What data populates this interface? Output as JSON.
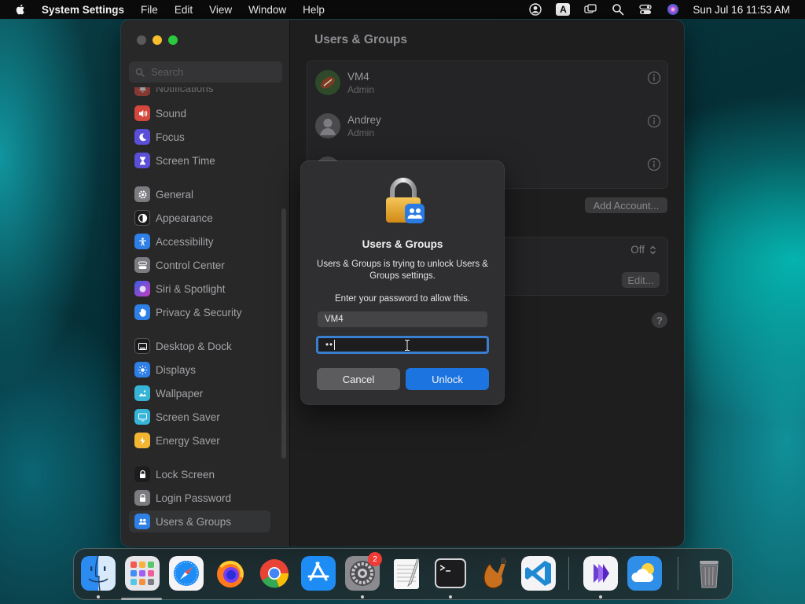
{
  "menubar": {
    "app_name": "System Settings",
    "items": [
      "File",
      "Edit",
      "View",
      "Window",
      "Help"
    ],
    "input_source": "A",
    "clock": "Sun Jul 16  11:53 AM"
  },
  "window": {
    "title": "Users & Groups",
    "search_placeholder": "Search",
    "sidebar": [
      {
        "label": "Notifications",
        "icon": "bell-icon",
        "color": "#e0473c"
      },
      {
        "label": "Sound",
        "icon": "speaker-icon",
        "color": "#e0473c"
      },
      {
        "label": "Focus",
        "icon": "moon-icon",
        "color": "#5b4fd8"
      },
      {
        "label": "Screen Time",
        "icon": "hourglass-icon",
        "color": "#5b4fd8"
      },
      {
        "label": "General",
        "icon": "gear-icon",
        "color": "#8e8e93"
      },
      {
        "label": "Appearance",
        "icon": "appearance-icon",
        "color": "#1c1c1e"
      },
      {
        "label": "Accessibility",
        "icon": "accessibility-icon",
        "color": "#2e7fe6"
      },
      {
        "label": "Control Center",
        "icon": "control-center-icon",
        "color": "#8e8e93"
      },
      {
        "label": "Siri & Spotlight",
        "icon": "siri-icon",
        "color": "#c53dc4"
      },
      {
        "label": "Privacy & Security",
        "icon": "hand-icon",
        "color": "#2e7fe6"
      },
      {
        "label": "Desktop & Dock",
        "icon": "dock-icon",
        "color": "#1c1c1e"
      },
      {
        "label": "Displays",
        "icon": "sun-icon",
        "color": "#2e7fe6"
      },
      {
        "label": "Wallpaper",
        "icon": "wallpaper-icon",
        "color": "#36b5d8"
      },
      {
        "label": "Screen Saver",
        "icon": "screen-saver-icon",
        "color": "#36b5d8"
      },
      {
        "label": "Energy Saver",
        "icon": "battery-icon",
        "color": "#f2b632"
      },
      {
        "label": "Lock Screen",
        "icon": "lock-icon",
        "color": "#1c1c1e"
      },
      {
        "label": "Login Password",
        "icon": "lock-icon",
        "color": "#8e8e93"
      },
      {
        "label": "Users & Groups",
        "icon": "users-icon",
        "color": "#2e7fe6"
      }
    ],
    "users": [
      {
        "name": "VM4",
        "role": "Admin"
      },
      {
        "name": "Andrey",
        "role": "Admin"
      },
      {
        "name": "",
        "role": ""
      }
    ],
    "add_account_label": "Add Account...",
    "guest_setting_value": "Off",
    "edit_label": "Edit...",
    "help_label": "?"
  },
  "dialog": {
    "title": "Users & Groups",
    "message": "Users & Groups is trying to unlock Users & Groups settings.",
    "prompt": "Enter your password to allow this.",
    "username": "VM4",
    "password_mask": "••",
    "cancel_label": "Cancel",
    "unlock_label": "Unlock"
  },
  "dock": {
    "apps": [
      "Finder",
      "Launchpad",
      "Safari",
      "Firefox",
      "Chrome",
      "App Store",
      "System Settings",
      "TextEdit",
      "Terminal",
      "Instruments",
      "Visual Studio Code",
      "Visual Studio",
      "Weather",
      "Trash"
    ],
    "badge": "2"
  }
}
